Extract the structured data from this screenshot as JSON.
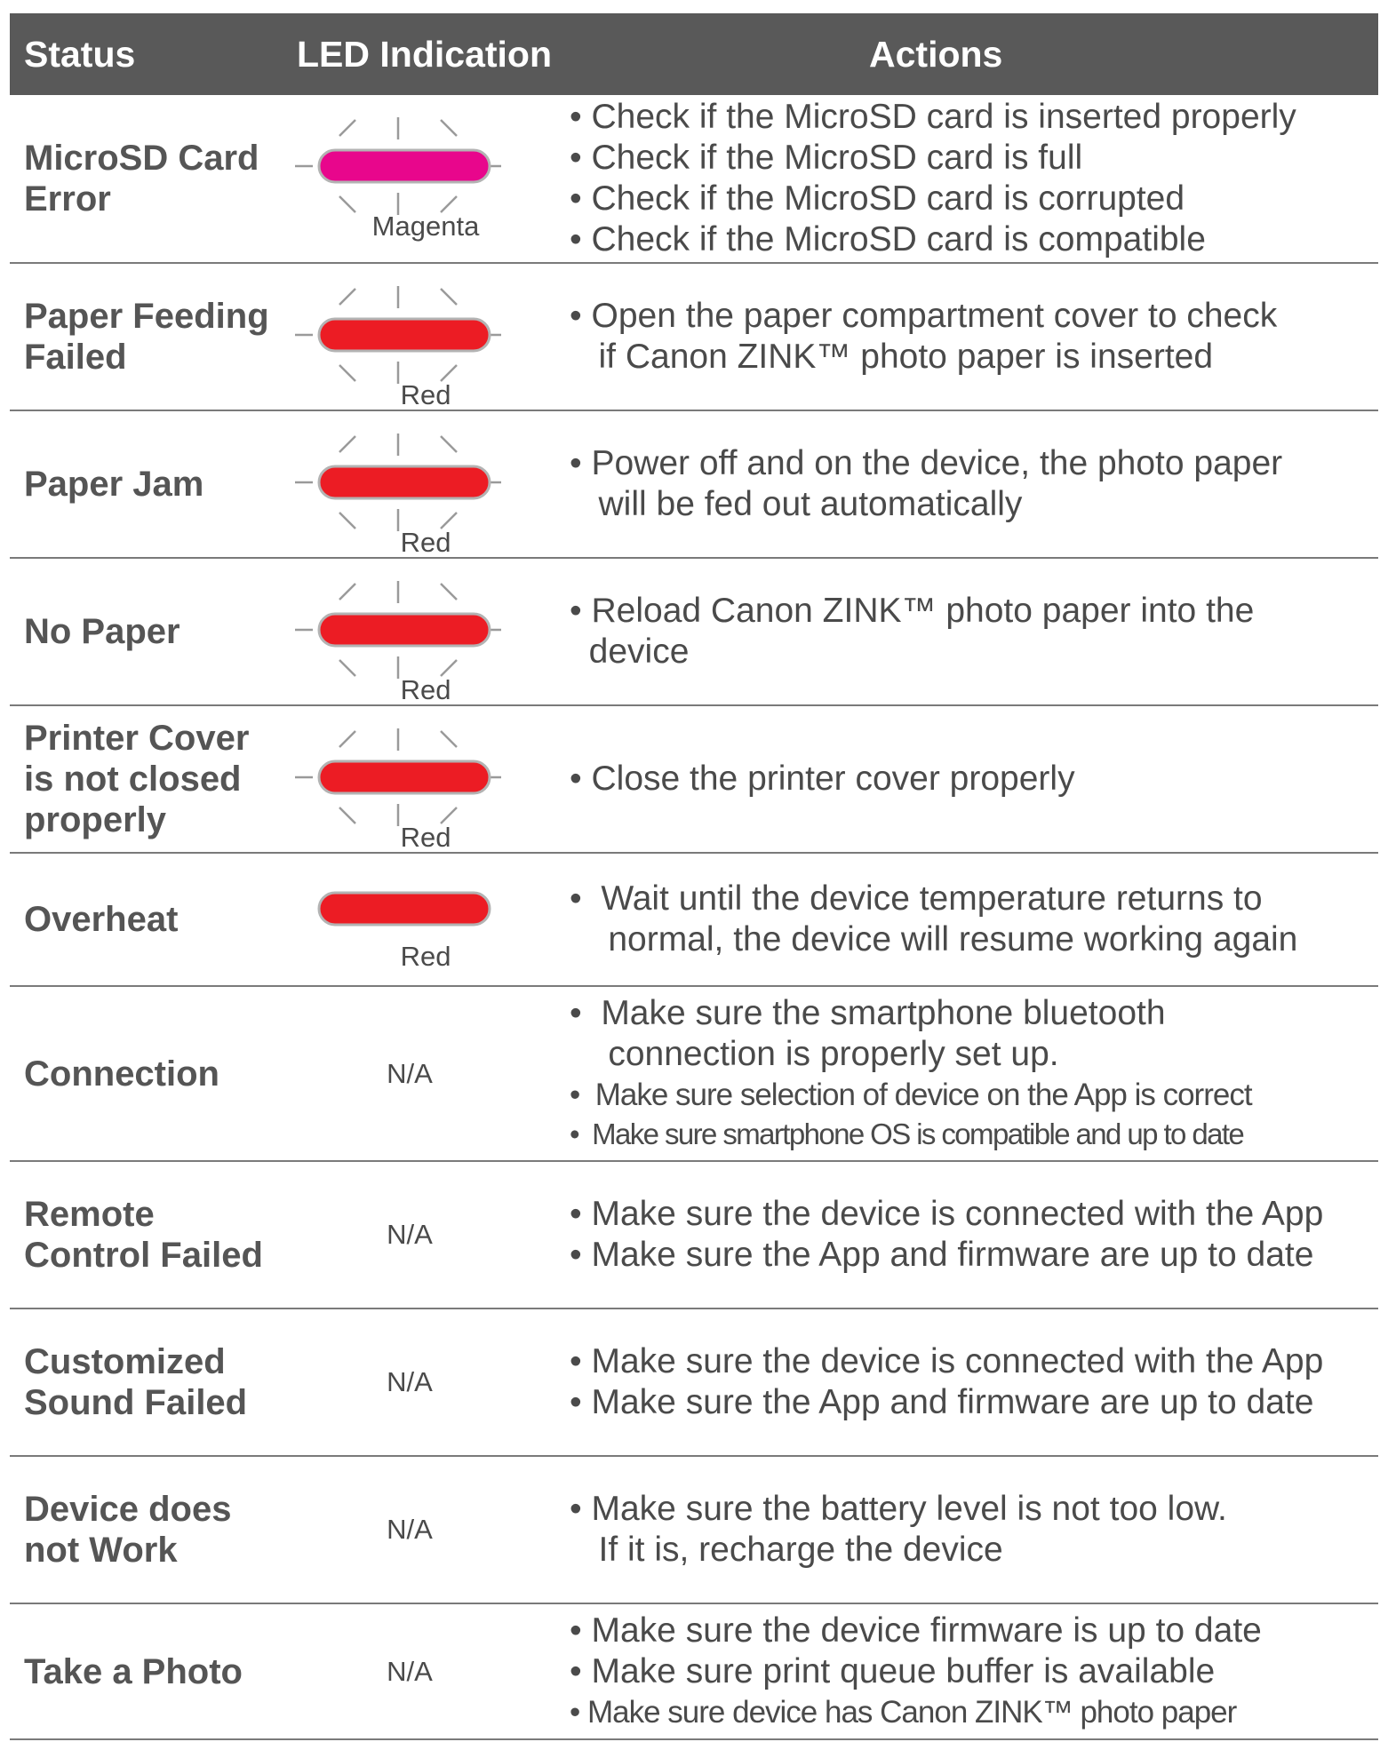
{
  "header": {
    "status": "Status",
    "led": "LED Indication",
    "actions": "Actions"
  },
  "colors": {
    "magenta": "#e8068c",
    "red": "#ec1c24",
    "header_bg": "#595959"
  },
  "rows": [
    {
      "status": "MicroSD Card\nError",
      "led": {
        "color": "magenta",
        "label": "Magenta",
        "blinking": true
      },
      "actions": [
        "• Check if the MicroSD card is inserted properly",
        "• Check if the MicroSD card is full",
        "• Check if the MicroSD card is corrupted",
        "• Check if the MicroSD card is compatible"
      ]
    },
    {
      "status": "Paper Feeding\nFailed",
      "led": {
        "color": "red",
        "label": "Red",
        "blinking": true
      },
      "actions": [
        "• Open the paper compartment cover to check",
        "   if Canon ZINK™ photo paper is inserted"
      ]
    },
    {
      "status": "Paper Jam",
      "led": {
        "color": "red",
        "label": "Red",
        "blinking": true
      },
      "actions": [
        "• Power off and on the device, the photo paper",
        "   will be fed out automatically"
      ]
    },
    {
      "status": "No Paper",
      "led": {
        "color": "red",
        "label": "Red",
        "blinking": true
      },
      "actions": [
        "• Reload Canon ZINK™ photo paper into the",
        "  device"
      ]
    },
    {
      "status": "Printer Cover\nis not closed\nproperly",
      "led": {
        "color": "red",
        "label": "Red",
        "blinking": true
      },
      "actions": [
        "• Close the printer cover properly"
      ]
    },
    {
      "status": "Overheat",
      "led": {
        "color": "red",
        "label": "Red",
        "blinking": false
      },
      "actions": [
        "•  Wait until the device temperature returns to",
        "    normal, the device will resume working again"
      ]
    },
    {
      "status": "Connection",
      "led": "N/A",
      "actions": [
        "•  Make sure the smartphone bluetooth",
        "    connection is properly set up.",
        "•  Make sure selection of device on the App is correct",
        "•  Make sure smartphone OS is compatible and up to date"
      ]
    },
    {
      "status": "Remote\nControl Failed",
      "led": "N/A",
      "actions": [
        "• Make sure the device is connected with the App",
        "• Make sure the App and firmware are up to date"
      ]
    },
    {
      "status": "Customized\nSound Failed",
      "led": "N/A",
      "actions": [
        "• Make sure the device is connected with the App",
        "• Make sure the App and firmware are up to date"
      ]
    },
    {
      "status": "Device does\nnot Work",
      "led": "N/A",
      "actions": [
        "• Make sure the battery level is not too low.",
        "   If it is, recharge the device"
      ]
    },
    {
      "status": "Take a Photo",
      "led": "N/A",
      "actions": [
        "• Make sure the device firmware is up to date",
        "• Make sure print queue buffer is available",
        "• Make sure device has Canon ZINK™ photo paper"
      ]
    }
  ]
}
